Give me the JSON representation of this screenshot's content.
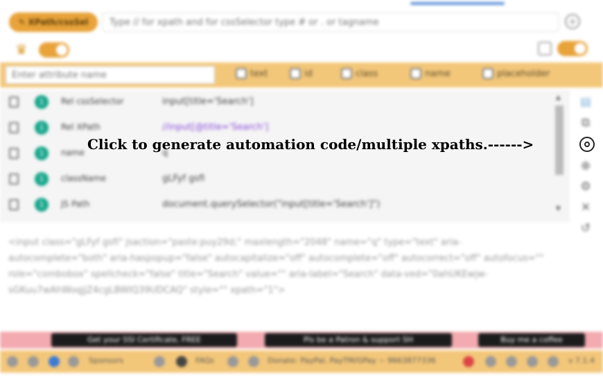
{
  "header": {
    "mode_button_label": "XPath/cssSel",
    "search_placeholder": "Type // for xpath and for cssSelector type # or . or tagname"
  },
  "attributes": {
    "input_placeholder": "Enter attribute name",
    "checkboxes": [
      "text",
      "id",
      "class",
      "name",
      "placeholder"
    ]
  },
  "results": [
    {
      "num": "1",
      "label": "Rel cssSelector",
      "value": "input[title='Search']"
    },
    {
      "num": "1",
      "label": "Rel XPath",
      "value": "//input[@title='Search']"
    },
    {
      "num": "1",
      "label": "name",
      "value": "q"
    },
    {
      "num": "1",
      "label": "className",
      "value": "gLFyf gsfi"
    },
    {
      "num": "1",
      "label": "JS Path",
      "value": "document.querySelector(\"input[title='Search']\")"
    }
  ],
  "html_output": "<input class=\"gLFyf gsfi\" jsaction=\"paste:puy29d;\" maxlength=\"2048\" name=\"q\" type=\"text\" aria-autocomplete=\"both\" aria-haspopup=\"false\" autocapitalize=\"off\" autocomplete=\"off\" autocorrect=\"off\" autofocus=\"\" role=\"combobox\" spellcheck=\"false\" title=\"Search\" value=\"\" aria-label=\"Search\" data-ved=\"0ahUKEwjw-sGKuu7wAhWoqjjZ4cgLBWIQ39UDCAQ\" style=\"\" xpath=\"1\">",
  "banners": [
    "Get your SSI Certificate, FREE",
    "Pls be a Patron & support SH",
    "Buy me a coffee"
  ],
  "footer": {
    "sponsors": "Sponsors",
    "faqs": "FAQs",
    "donate": "Donate: PayPal, PayTM/GPay ~ 9663877336",
    "version": "v 7.1.4"
  },
  "callout": "Click to generate automation code/multiple xpaths.------>"
}
